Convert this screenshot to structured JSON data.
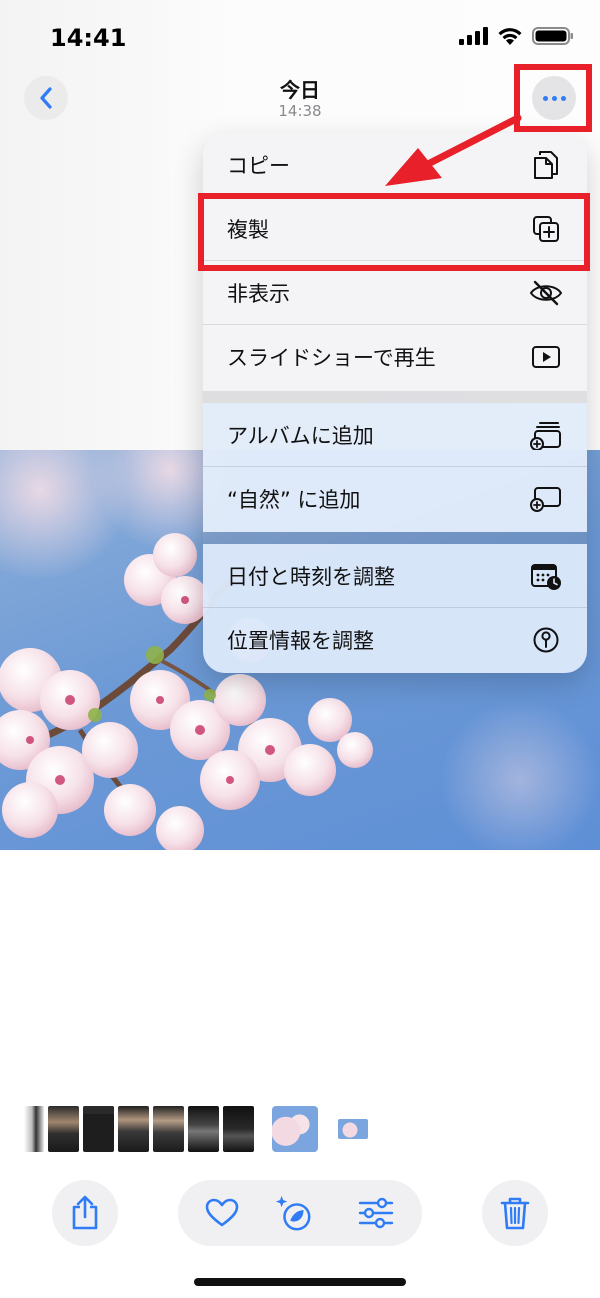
{
  "status": {
    "time": "14:41"
  },
  "header": {
    "title": "今日",
    "subtitle": "14:38"
  },
  "menu": {
    "sections": [
      {
        "items": [
          {
            "label": "コピー",
            "icon": "copy-icon"
          },
          {
            "label": "複製",
            "icon": "duplicate-icon"
          },
          {
            "label": "非表示",
            "icon": "eye-slash-icon"
          },
          {
            "label": "スライドショーで再生",
            "icon": "play-icon"
          }
        ]
      },
      {
        "items": [
          {
            "label": "アルバムに追加",
            "icon": "add-to-album-icon"
          },
          {
            "label": "“自然” に追加",
            "icon": "add-to-album-icon"
          }
        ]
      },
      {
        "items": [
          {
            "label": "日付と時刻を調整",
            "icon": "calendar-clock-icon"
          },
          {
            "label": "位置情報を調整",
            "icon": "location-icon"
          }
        ]
      }
    ]
  },
  "toolbar": {
    "left": {
      "icon": "share-icon"
    },
    "center": [
      {
        "icon": "heart-icon"
      },
      {
        "icon": "magic-retouch-icon"
      },
      {
        "icon": "sliders-icon"
      }
    ],
    "right": {
      "icon": "trash-icon"
    }
  },
  "colors": {
    "accent": "#2f7cf6",
    "annotation": "#e8202a",
    "sky": "#6d9ad6",
    "blossom": "#f3d9e2"
  }
}
